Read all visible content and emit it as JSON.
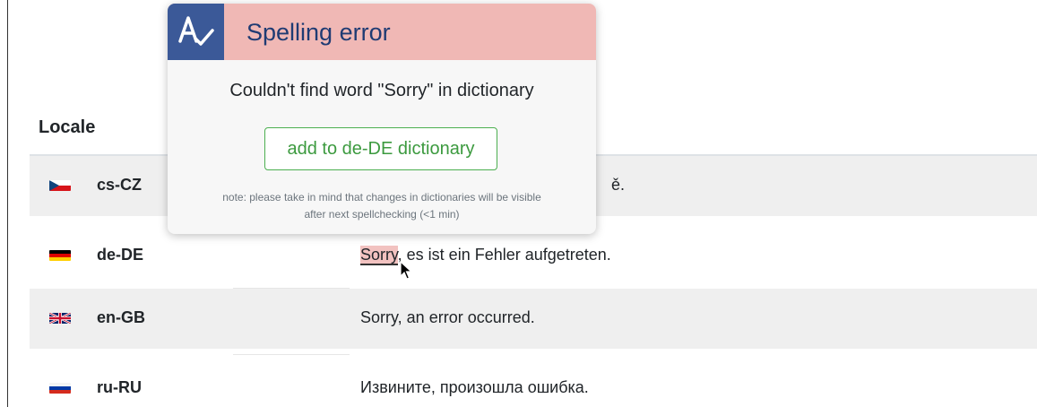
{
  "table": {
    "header": {
      "locale": "Locale"
    },
    "rows": [
      {
        "flag": "czech-flag-icon",
        "locale": "cs-CZ",
        "text": "ě."
      },
      {
        "flag": "german-flag-icon",
        "locale": "de-DE",
        "text_misspelled": "Sorry",
        "text_rest": ", es ist ein Fehler aufgetreten."
      },
      {
        "flag": "uk-flag-icon",
        "locale": "en-GB",
        "text": "Sorry, an error occurred."
      },
      {
        "flag": "russian-flag-icon",
        "locale": "ru-RU",
        "text": "Извините, произошла ошибка."
      }
    ]
  },
  "popup": {
    "logo": "spellcheck-icon",
    "title": "Spelling error",
    "message": "Couldn't find word \"Sorry\" in dictionary",
    "button_label": "add to de-DE dictionary",
    "note_line1": "note: please take in mind that changes in dictionaries will be visible",
    "note_line2": "after next spellchecking (<1 min)",
    "header_color": "#f0b8b5",
    "logo_color": "#3b5998",
    "button_color": "#4caf50"
  },
  "colors": {
    "striped_row": "#efefef",
    "misspelled_highlight": "#f2c2c0"
  }
}
